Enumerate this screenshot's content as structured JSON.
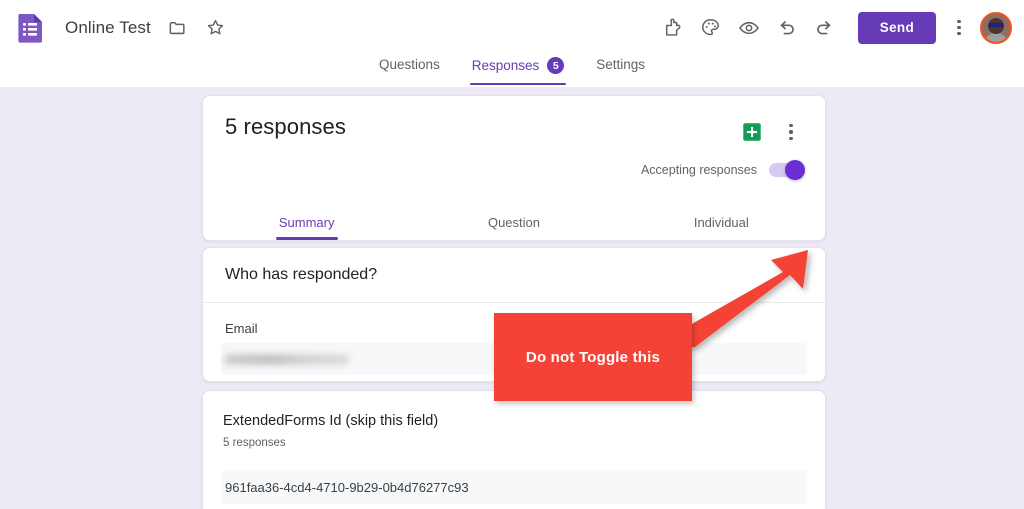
{
  "topbar": {
    "logo_icon": "forms-document-icon",
    "doc_title": "Online Test",
    "folder_icon": "folder-icon",
    "star_icon": "star-icon",
    "icons": [
      {
        "name": "addons-puzzle-icon",
        "label": "Add-ons"
      },
      {
        "name": "palette-icon",
        "label": "Customize theme"
      },
      {
        "name": "eye-preview-icon",
        "label": "Preview"
      },
      {
        "name": "undo-icon",
        "label": "Undo"
      },
      {
        "name": "redo-icon",
        "label": "Redo"
      }
    ],
    "send_label": "Send",
    "more_icon": "more-vertical-icon",
    "avatar_icon": "user-avatar",
    "accent_color": "#673ab7"
  },
  "nav": {
    "tabs": [
      {
        "label": "Questions",
        "active": false,
        "badge": ""
      },
      {
        "label": "Responses",
        "active": true,
        "badge": "5"
      },
      {
        "label": "Settings",
        "active": false,
        "badge": ""
      }
    ]
  },
  "responses_card": {
    "count_title": "5 responses",
    "sheets_icon": "google-sheets-icon",
    "sheets_icon_color": "#0f9d58",
    "more_icon": "more-vertical-icon",
    "accepting_label": "Accepting responses",
    "accepting_state": "on",
    "toggle_color": "#6a2fd4",
    "subtabs": [
      {
        "label": "Summary",
        "active": true
      },
      {
        "label": "Question",
        "active": false
      },
      {
        "label": "Individual",
        "active": false
      }
    ]
  },
  "responded_card": {
    "title": "Who has responded?",
    "field_label": "Email",
    "field_value": "",
    "field_redacted": true
  },
  "extended_card": {
    "question_title": "ExtendedForms Id (skip this field)",
    "response_count": "5 responses",
    "answer_value": "961faa36-4cd4-4710-9b29-0b4d76277c93"
  },
  "annotation": {
    "text": "Do not Toggle this",
    "color": "#f44336",
    "arrow_icon": "arrow-pointing-up-right"
  },
  "theme": {
    "page_background": "#ede9f5",
    "card_background": "#ffffff",
    "purple": "#673ab7"
  }
}
